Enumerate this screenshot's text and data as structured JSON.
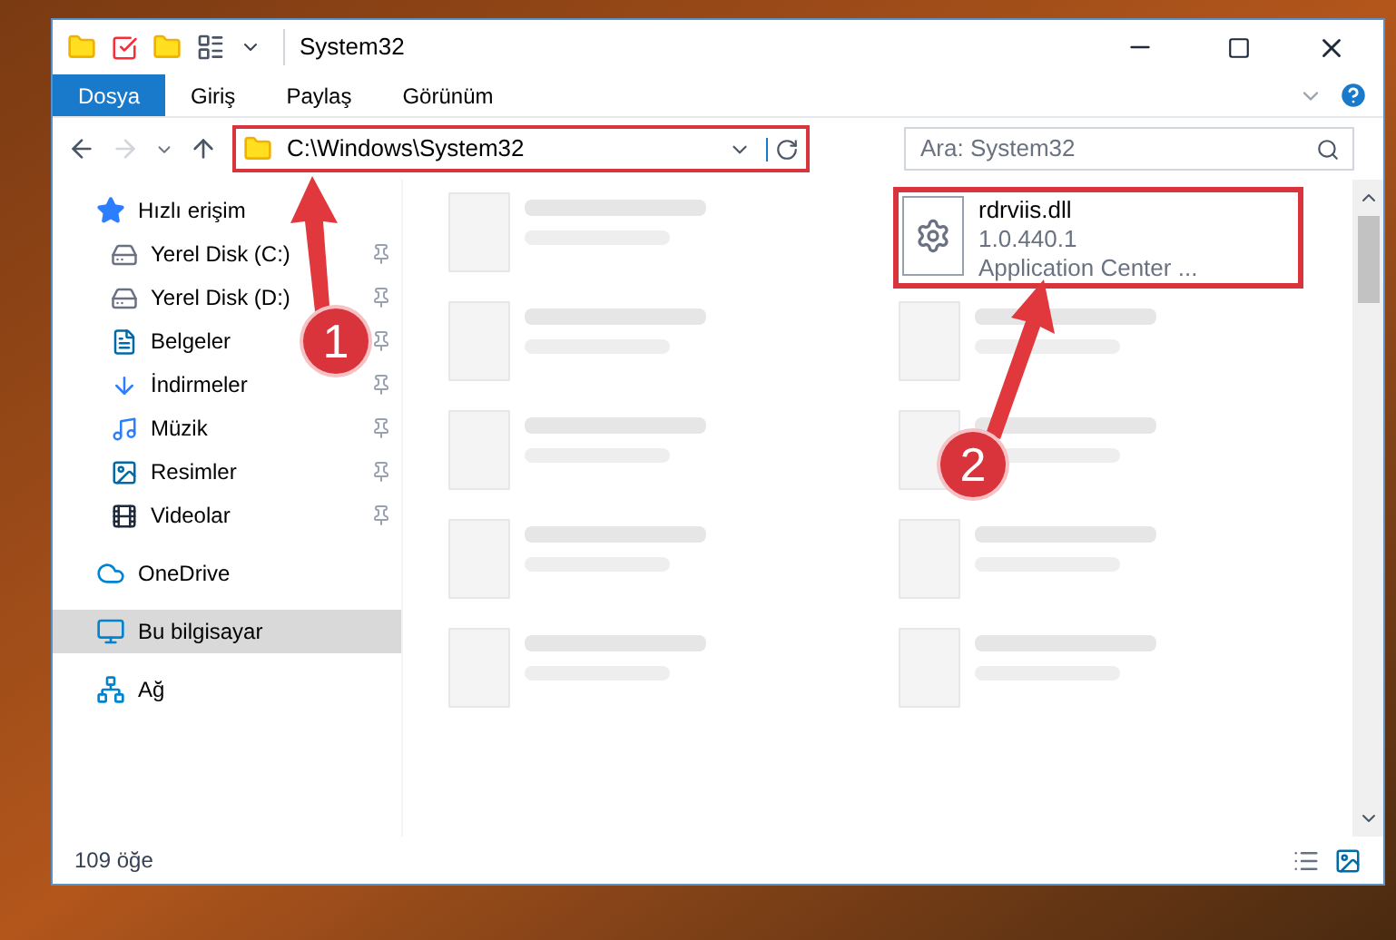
{
  "window": {
    "title": "System32"
  },
  "ribbon_tabs": [
    {
      "label": "Dosya",
      "selected": true
    },
    {
      "label": "Giriş",
      "selected": false
    },
    {
      "label": "Paylaş",
      "selected": false
    },
    {
      "label": "Görünüm",
      "selected": false
    }
  ],
  "address_bar": {
    "path": "C:\\Windows\\System32"
  },
  "search": {
    "placeholder": "Ara: System32"
  },
  "sidebar": {
    "items": [
      {
        "label": "Hızlı erişim",
        "selected": false,
        "children": [
          {
            "label": "Yerel Disk (C:)",
            "pinned": true
          },
          {
            "label": "Yerel Disk (D:)",
            "pinned": true
          },
          {
            "label": "Belgeler",
            "pinned": true
          },
          {
            "label": "İndirmeler",
            "pinned": true
          },
          {
            "label": "Müzik",
            "pinned": true
          },
          {
            "label": "Resimler",
            "pinned": true
          },
          {
            "label": "Videolar",
            "pinned": true
          }
        ]
      },
      {
        "label": "OneDrive",
        "selected": false
      },
      {
        "label": "Bu bilgisayar",
        "selected": true
      },
      {
        "label": "Ağ",
        "selected": false
      }
    ]
  },
  "files": [
    {
      "blurred": true
    },
    {
      "name": "rdrviis.dll",
      "details": [
        "1.0.440.1",
        "Application Center ..."
      ],
      "blurred": false,
      "highlighted": true
    },
    {
      "blurred": true
    },
    {
      "blurred": true
    },
    {
      "blurred": true
    },
    {
      "blurred": true
    },
    {
      "blurred": true
    },
    {
      "blurred": true
    },
    {
      "blurred": true
    },
    {
      "blurred": true
    }
  ],
  "status_bar": {
    "item_count": "109 öğe"
  },
  "annotations": [
    {
      "label": "1"
    },
    {
      "label": "2"
    }
  ]
}
